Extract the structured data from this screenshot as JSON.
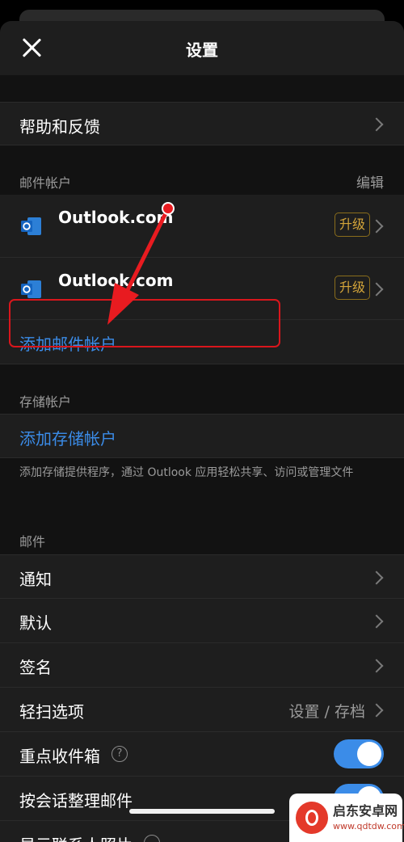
{
  "header": {
    "title": "设置"
  },
  "help": {
    "label": "帮助和反馈"
  },
  "mail_accounts": {
    "section_title": "邮件帐户",
    "edit_label": "编辑",
    "accounts": [
      {
        "name": "Outlook.com",
        "badge": "升级"
      },
      {
        "name": "Outlook.com",
        "badge": "升级"
      }
    ],
    "add_label": "添加邮件帐户"
  },
  "storage": {
    "section_title": "存储帐户",
    "add_label": "添加存储帐户",
    "description": "添加存储提供程序，通过 Outlook 应用轻松共享、访问或管理文件"
  },
  "mail": {
    "section_title": "邮件",
    "notifications": "通知",
    "defaults": "默认",
    "signature": "签名",
    "swipe": {
      "label": "轻扫选项",
      "value": "设置 / 存档"
    },
    "focused_inbox": {
      "label": "重点收件箱",
      "help": "?"
    },
    "conversation": {
      "label": "按会话整理邮件"
    },
    "contact_photos": {
      "label": "显示联系人照片"
    }
  },
  "watermark": {
    "title": "启东安卓网",
    "url": "www.qdtdw.com"
  },
  "colors": {
    "accent": "#3b8ce8",
    "annotation": "#d9161c",
    "badge": "#d4a53a"
  },
  "icons": [
    "close-icon",
    "chevron-right-icon",
    "outlook-icon",
    "help-circle-icon"
  ]
}
